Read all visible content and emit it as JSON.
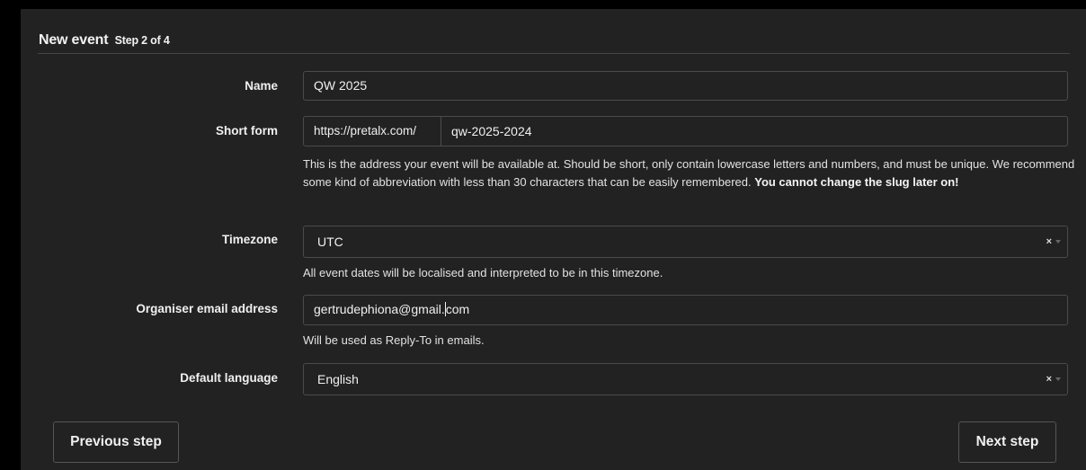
{
  "header": {
    "title": "New event",
    "step": "Step 2 of 4"
  },
  "form": {
    "name": {
      "label": "Name",
      "value": "QW 2025"
    },
    "short_form": {
      "label": "Short form",
      "prefix": "https://pretalx.com/",
      "value": "qw-2025-2024",
      "help_text": "This is the address your event will be available at. Should be short, only contain lowercase letters and numbers, and must be unique. We recommend some kind of abbreviation with less than 30 characters that can be easily remembered.",
      "help_bold": "You cannot change the slug later on!"
    },
    "timezone": {
      "label": "Timezone",
      "value": "UTC",
      "help_text": "All event dates will be localised and interpreted to be in this timezone."
    },
    "email": {
      "label": "Organiser email address",
      "value_before_caret": "gertrudephiona@gmail.",
      "value_after_caret": "com",
      "help_text": "Will be used as Reply-To in emails."
    },
    "language": {
      "label": "Default language",
      "value": "English"
    },
    "clear_symbol": "×"
  },
  "buttons": {
    "previous": "Previous step",
    "next": "Next step"
  },
  "colors": {
    "background": "#000000",
    "panel": "#222222",
    "border": "#4b4b4b",
    "text": "#f0f0f0"
  },
  "icons": {
    "clear": "clear-icon",
    "dropdown": "chevron-down-icon"
  }
}
